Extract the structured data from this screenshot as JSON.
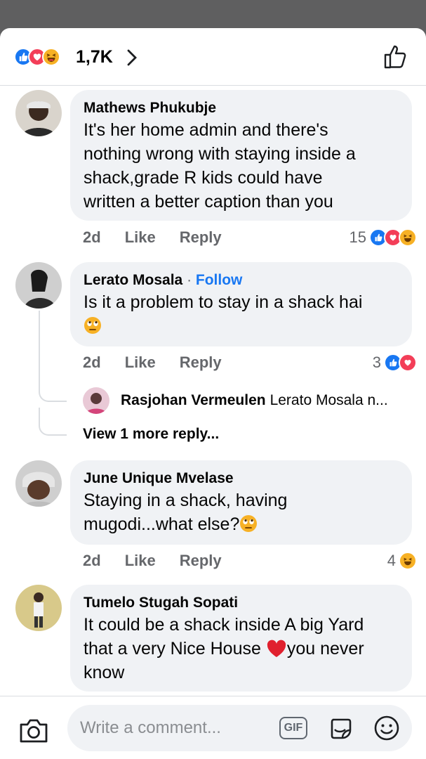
{
  "header": {
    "reaction_count": "1,7K",
    "reactions": [
      "like",
      "love",
      "haha"
    ]
  },
  "comments": [
    {
      "author": "Mathews Phukubje",
      "text_lines": [
        "It's her home admin and there's",
        "nothing wrong with staying inside a",
        "shack,grade R kids could have",
        "written a better caption than you"
      ],
      "time": "2d",
      "like": "Like",
      "reply": "Reply",
      "reaction_count": "15",
      "reactions": [
        "like",
        "love",
        "haha"
      ]
    },
    {
      "author": "Lerato Mosala",
      "separator": "·",
      "follow": "Follow",
      "text_lines": [
        "Is it a problem to stay in a shack hai"
      ],
      "emoji": "rolling-eyes",
      "time": "2d",
      "like": "Like",
      "reply": "Reply",
      "reaction_count": "3",
      "reactions": [
        "like",
        "love"
      ],
      "replies": {
        "author": "Rasjohan Vermeulen",
        "preview": "Lerato Mosala n...",
        "view_more": "View 1 more reply..."
      }
    },
    {
      "author": "June Unique Mvelase",
      "text_lines": [
        "Staying in a shack, having",
        "mugodi...what else?"
      ],
      "time": "2d",
      "like": "Like",
      "reply": "Reply",
      "reaction_count": "4",
      "reactions": [
        "haha"
      ]
    },
    {
      "author": "Tumelo Stugah Sopati",
      "text_lines": [
        "It could be a shack inside A big Yard",
        "that a very Nice House",
        "you never",
        "know"
      ]
    }
  ],
  "composer": {
    "placeholder": "Write a comment...",
    "gif_label": "GIF"
  },
  "colors": {
    "like": "#1877f2",
    "love": "#f33e58",
    "haha": "#f7b125",
    "link": "#1877f2",
    "bubble": "#f0f2f5",
    "muted": "#65676b"
  }
}
